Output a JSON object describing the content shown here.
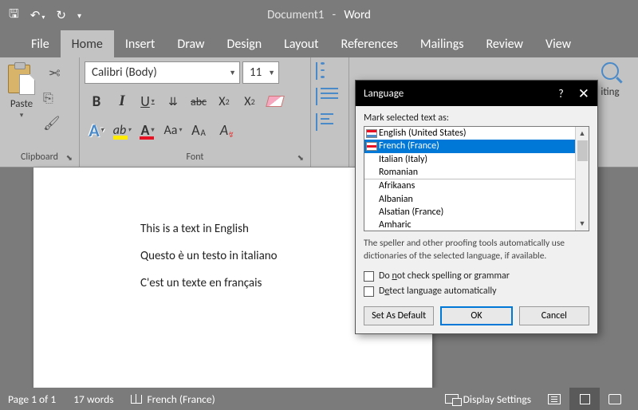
{
  "titlebar": {
    "doc": "Document1",
    "app": "Word"
  },
  "tabs": [
    "File",
    "Home",
    "Insert",
    "Draw",
    "Design",
    "Layout",
    "References",
    "Mailings",
    "Review",
    "View"
  ],
  "activeTab": "Home",
  "clipboard": {
    "paste": "Paste",
    "groupLabel": "Clipboard"
  },
  "font": {
    "name": "Calibri (Body)",
    "size": "11",
    "groupLabel": "Font",
    "bold": "B",
    "italic": "I",
    "underline": "U",
    "strike": "abc",
    "sub": "X",
    "sup": "X",
    "effects": "A",
    "highlight": "ab",
    "color": "A",
    "case": "Aa",
    "grow": "A",
    "growSm": "A",
    "clear": "A"
  },
  "editing": {
    "label": "iting"
  },
  "document": {
    "lines": [
      "This is a text in English",
      "Questo è un testo in italiano",
      "C'est un texte en français"
    ]
  },
  "dialog": {
    "title": "Language",
    "markLabel": "Mark selected text as:",
    "languages": [
      {
        "name": "English (United States)",
        "icon": true,
        "selected": false
      },
      {
        "name": "French (France)",
        "icon": true,
        "selected": true
      },
      {
        "name": "Italian (Italy)",
        "icon": false,
        "selected": false
      },
      {
        "name": "Romanian",
        "icon": false,
        "selected": false
      },
      {
        "name": "Afrikaans",
        "icon": false,
        "selected": false,
        "divider": true
      },
      {
        "name": "Albanian",
        "icon": false,
        "selected": false
      },
      {
        "name": "Alsatian (France)",
        "icon": false,
        "selected": false
      },
      {
        "name": "Amharic",
        "icon": false,
        "selected": false
      }
    ],
    "info": "The speller and other proofing tools automatically use dictionaries of the selected language, if available.",
    "chk1a": "Do ",
    "chk1u": "n",
    "chk1b": "ot check spelling or grammar",
    "chk2a": "D",
    "chk2u": "e",
    "chk2b": "tect language automatically",
    "setDefault": "Set As Default",
    "ok": "OK",
    "cancel": "Cancel"
  },
  "statusbar": {
    "page": "Page 1 of 1",
    "words": "17 words",
    "language": "French (France)",
    "display": "Display Settings"
  }
}
